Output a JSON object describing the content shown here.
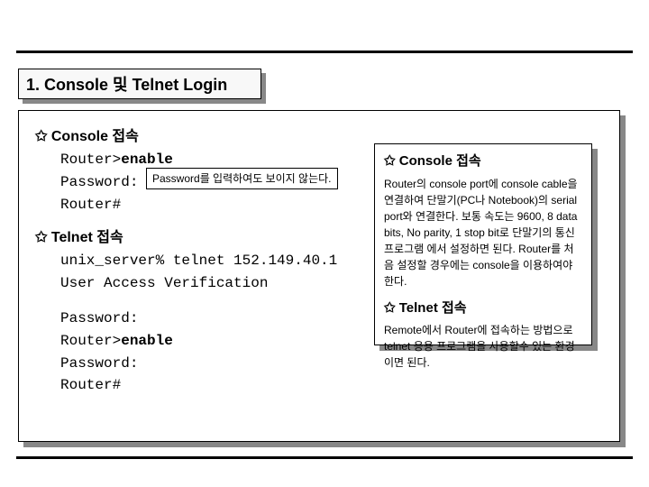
{
  "title": "1.  Console 및 Telnet Login",
  "main": {
    "h1": "Console 접속",
    "c1": {
      "l1": "Router>",
      "l1b": "enable",
      "l2": "Password:",
      "callout": "Password를 입력하여도 보이지 않는다.",
      "l3": "Router#"
    },
    "h2": "Telnet 접속",
    "c2": {
      "l1": "unix_server% telnet 152.149.40.1",
      "l2": "User Access Verification",
      "l3": "Password:",
      "l4": "Router>",
      "l4b": "enable",
      "l5": "Password:",
      "l6": "Router#"
    }
  },
  "side": {
    "h1": "Console 접속",
    "p1": "Router의 console port에 console cable을 연결하여 단말기(PC나 Notebook)의 serial port와 연결한다. 보통 속도는 9600, 8 data bits, No parity, 1 stop bit로 단말기의 통신 프로그램 에서 설정하면 된다. Router를 처음 설정할 경우에는 console을 이용하여야 한다.",
    "h2": "Telnet 접속",
    "p2": "Remote에서 Router에 접속하는 방법으로 telnet 응용 프로그램을 사용할수 있는 환경이면 된다."
  }
}
